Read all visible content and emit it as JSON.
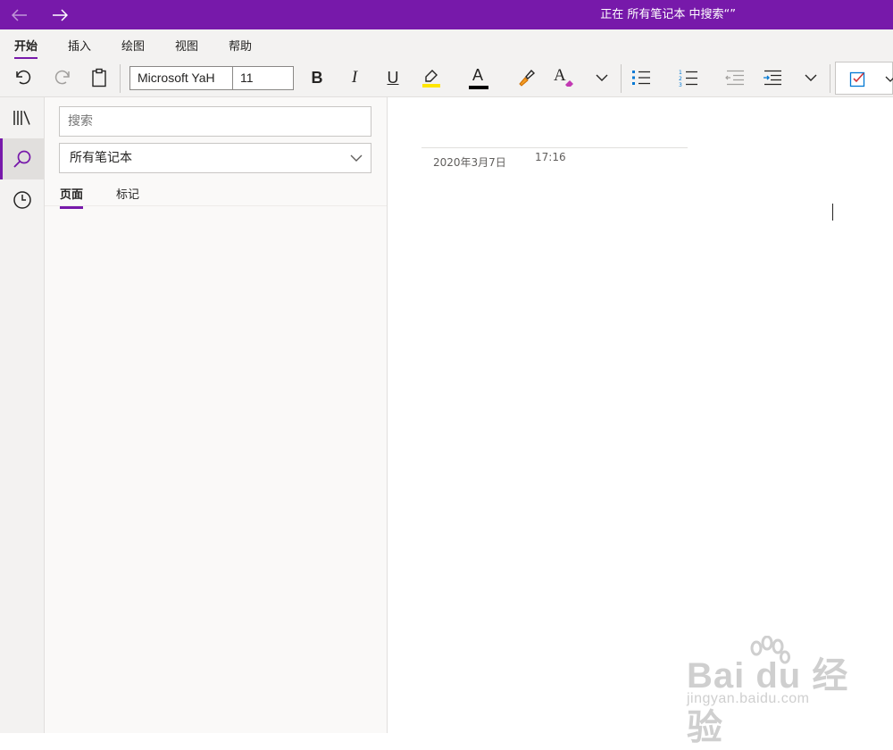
{
  "titlebar": {
    "title": "正在 所有笔记本 中搜索“”"
  },
  "menu": {
    "tabs": [
      {
        "label": "开始",
        "active": true
      },
      {
        "label": "插入"
      },
      {
        "label": "绘图"
      },
      {
        "label": "视图"
      },
      {
        "label": "帮助"
      }
    ]
  },
  "ribbon": {
    "font_name": "Microsoft YaH",
    "font_size": "11",
    "bold_label": "B",
    "italic_label": "I",
    "underline_label": "U",
    "font_color_label": "A",
    "style_label": "A",
    "highlight_color": "#ffe600",
    "font_color": "#000000"
  },
  "rail": {
    "items": [
      {
        "icon": "notebooks-icon"
      },
      {
        "icon": "search-icon",
        "active": true
      },
      {
        "icon": "recent-clock-icon"
      }
    ]
  },
  "search_pane": {
    "search_placeholder": "搜索",
    "scope": "所有笔记本",
    "tabs": [
      {
        "label": "页面",
        "active": true
      },
      {
        "label": "标记"
      }
    ]
  },
  "page": {
    "date": "2020年3月7日",
    "time": "17:16"
  },
  "watermark": {
    "logo_text": "Bai du 经验",
    "url_text": "jingyan.baidu.com"
  },
  "colors": {
    "accent": "#7719aa"
  }
}
